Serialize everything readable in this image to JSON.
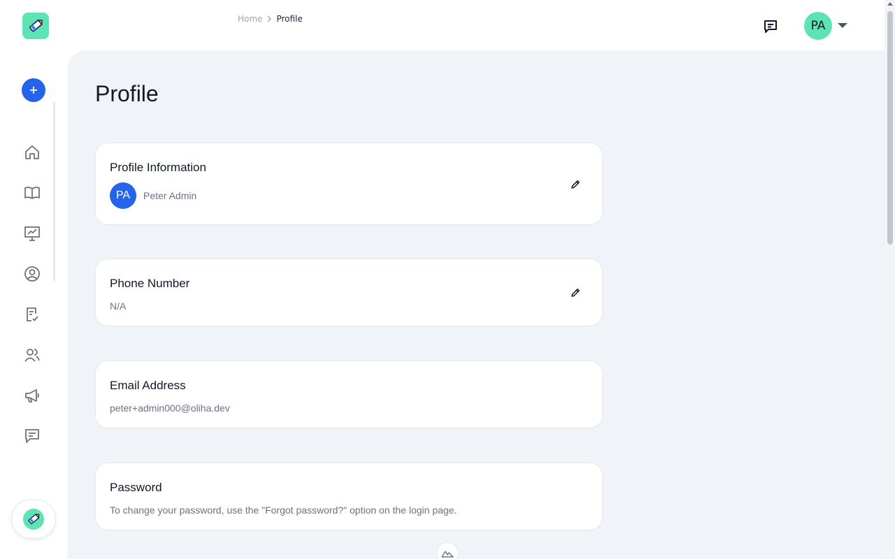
{
  "breadcrumb": {
    "home": "Home",
    "current": "Profile"
  },
  "user": {
    "initials": "PA",
    "name": "Peter Admin"
  },
  "page": {
    "title": "Profile"
  },
  "cards": {
    "profile": {
      "title": "Profile Information"
    },
    "phone": {
      "title": "Phone Number",
      "value": "N/A"
    },
    "email": {
      "title": "Email Address",
      "value": "peter+admin000@oliha.dev"
    },
    "password": {
      "title": "Password",
      "value": "To change your password, use the \"Forgot password?\" option on the login page."
    }
  },
  "sidebar": {
    "items": [
      {
        "icon": "home-icon"
      },
      {
        "icon": "book-icon"
      },
      {
        "icon": "presentation-chart-icon"
      },
      {
        "icon": "user-circle-icon"
      },
      {
        "icon": "clipboard-check-icon"
      },
      {
        "icon": "users-icon"
      },
      {
        "icon": "megaphone-icon"
      },
      {
        "icon": "chat-icon"
      }
    ]
  },
  "colors": {
    "accent": "#2563eb",
    "brand": "#5ee3b4",
    "background": "#f0f3f8"
  }
}
